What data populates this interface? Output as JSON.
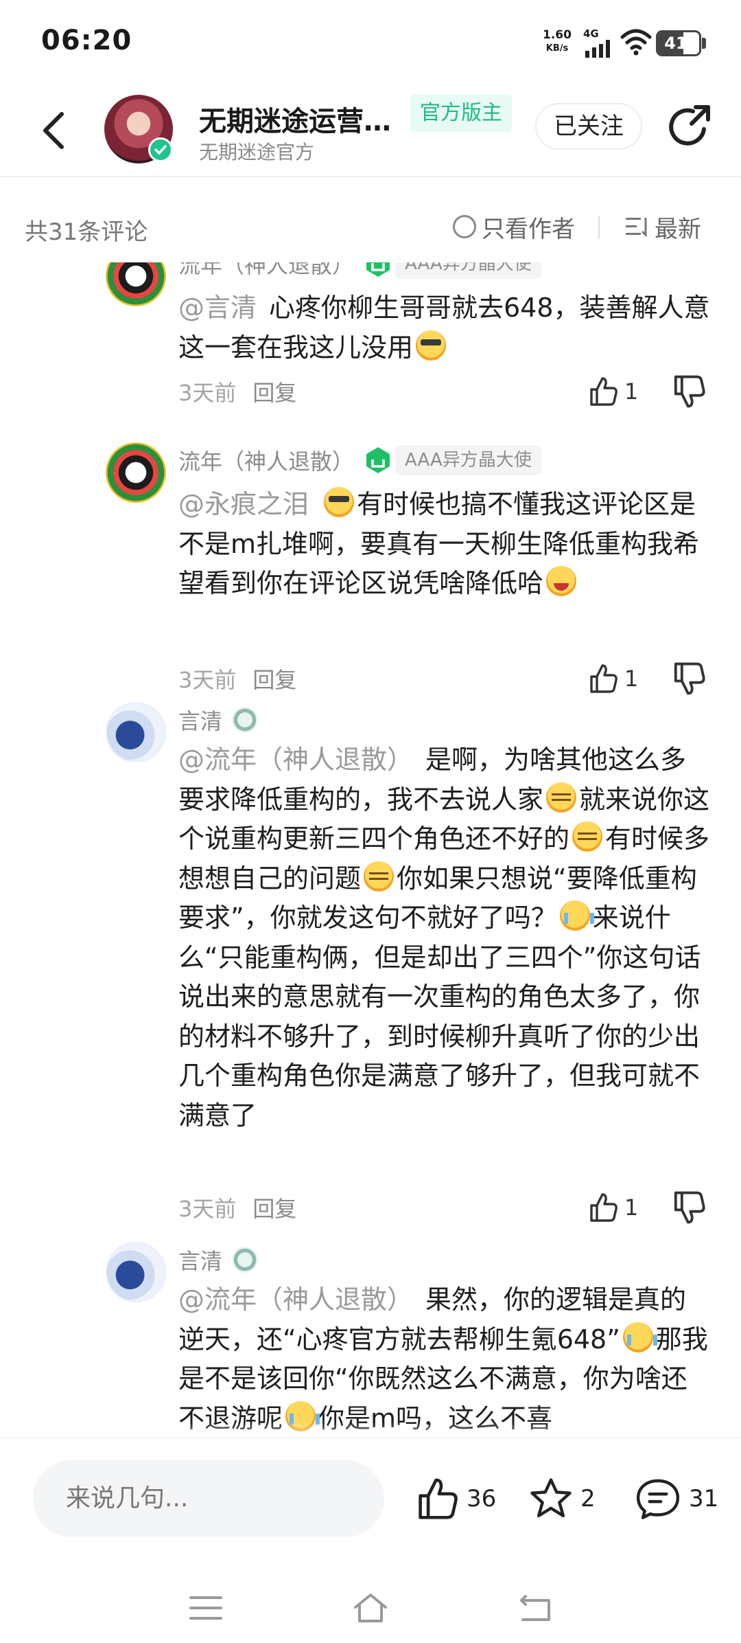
{
  "status_bar": {
    "time": "06:20",
    "net_speed_value": "1.60",
    "net_speed_unit": "KB/s",
    "network": "4G",
    "battery": "41",
    "battery_level": 0.41
  },
  "header": {
    "title": "无期迷途运营…",
    "badge": "官方版主",
    "subtitle": "无期迷途官方",
    "follow_label": "已关注"
  },
  "summary": {
    "count_label": "共31条评论",
    "only_author_label": "只看作者",
    "sort_label": "最新"
  },
  "comments": [
    {
      "user": "流年（神人退散）",
      "tag": "AAA异方晶大使",
      "mention": "@言清",
      "text": "心疼你柳生哥哥就去648，装善解人意这一套在我这儿没用",
      "time": "3天前",
      "reply_label": "回复",
      "likes": "1"
    },
    {
      "user": "流年（神人退散）",
      "tag": "AAA异方晶大使",
      "mention": "@永痕之泪",
      "text": "有时候也搞不懂我这评论区是不是m扎堆啊，要真有一天柳生降低重构我希望看到你在评论区说凭啥降低哈",
      "time": "3天前",
      "reply_label": "回复",
      "likes": "1"
    },
    {
      "user": "言清",
      "mention": "@流年（神人退散）",
      "text_parts": [
        "是啊，为啥其他这么多要求降低重构的，我不去说人家",
        "就来说你这个说重构更新三四个角色还不好的",
        "有时候多想想自己的问题",
        "你如果只想说“要降低重构要求”，你就发这句不就好了吗？",
        "来说什么“只能重构俩，但是却出了三四个”你这句话说出来的意思就有一次重构的角色太多了，你的材料不够升了，到时候柳升真听了你的少出几个重构角色你是满意了够升了，但我可就不满意了"
      ],
      "time": "3天前",
      "reply_label": "回复",
      "likes": "1"
    },
    {
      "user": "言清",
      "mention": "@流年（神人退散）",
      "text_parts": [
        "果然，你的逻辑是真的逆天，还“心疼官方就去帮柳生氪648”",
        "那我是不是该回你“你既然这么不满意，你为啥还不退游呢",
        "你是m吗，这么不喜"
      ]
    }
  ],
  "action_bar": {
    "input_placeholder": "来说几句...",
    "likes": "36",
    "favorites": "2",
    "comments": "31"
  },
  "icons": [
    "back-icon",
    "verified-icon",
    "share-icon",
    "radio-icon",
    "sort-icon",
    "thumb-up-icon",
    "thumb-down-icon",
    "star-icon",
    "comment-icon",
    "menu-icon",
    "home-icon",
    "back-nav-icon"
  ],
  "colors": {
    "accent": "#1fb98a",
    "badge_bg": "#e7faf3"
  }
}
